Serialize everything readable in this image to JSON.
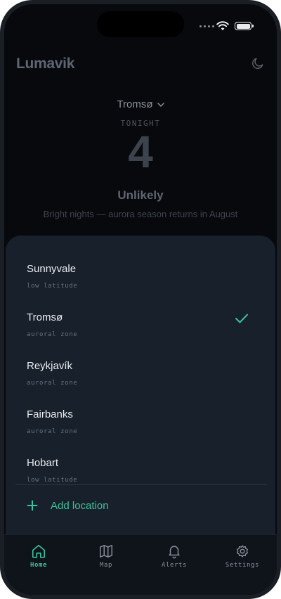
{
  "app": {
    "title": "Lumavik"
  },
  "hero": {
    "location": "Tromsø",
    "period": "TONIGHT",
    "kp": "4",
    "likelihood": "Unlikely",
    "note": "Bright nights — aurora season returns in August"
  },
  "sheet": {
    "locations": [
      {
        "name": "Sunnyvale",
        "zone": "low latitude",
        "selected": false
      },
      {
        "name": "Tromsø",
        "zone": "auroral zone",
        "selected": true
      },
      {
        "name": "Reykjavík",
        "zone": "auroral zone",
        "selected": false
      },
      {
        "name": "Fairbanks",
        "zone": "auroral zone",
        "selected": false
      },
      {
        "name": "Hobart",
        "zone": "low latitude",
        "selected": false
      }
    ],
    "add_label": "Add location"
  },
  "tabs": [
    {
      "label": "Home",
      "icon": "home-icon",
      "active": true
    },
    {
      "label": "Map",
      "icon": "map-icon",
      "active": false
    },
    {
      "label": "Alerts",
      "icon": "bell-icon",
      "active": false
    },
    {
      "label": "Settings",
      "icon": "gear-icon",
      "active": false
    }
  ],
  "colors": {
    "accent": "#3cc29a",
    "sheet": "#18202b",
    "background": "#07090d"
  }
}
